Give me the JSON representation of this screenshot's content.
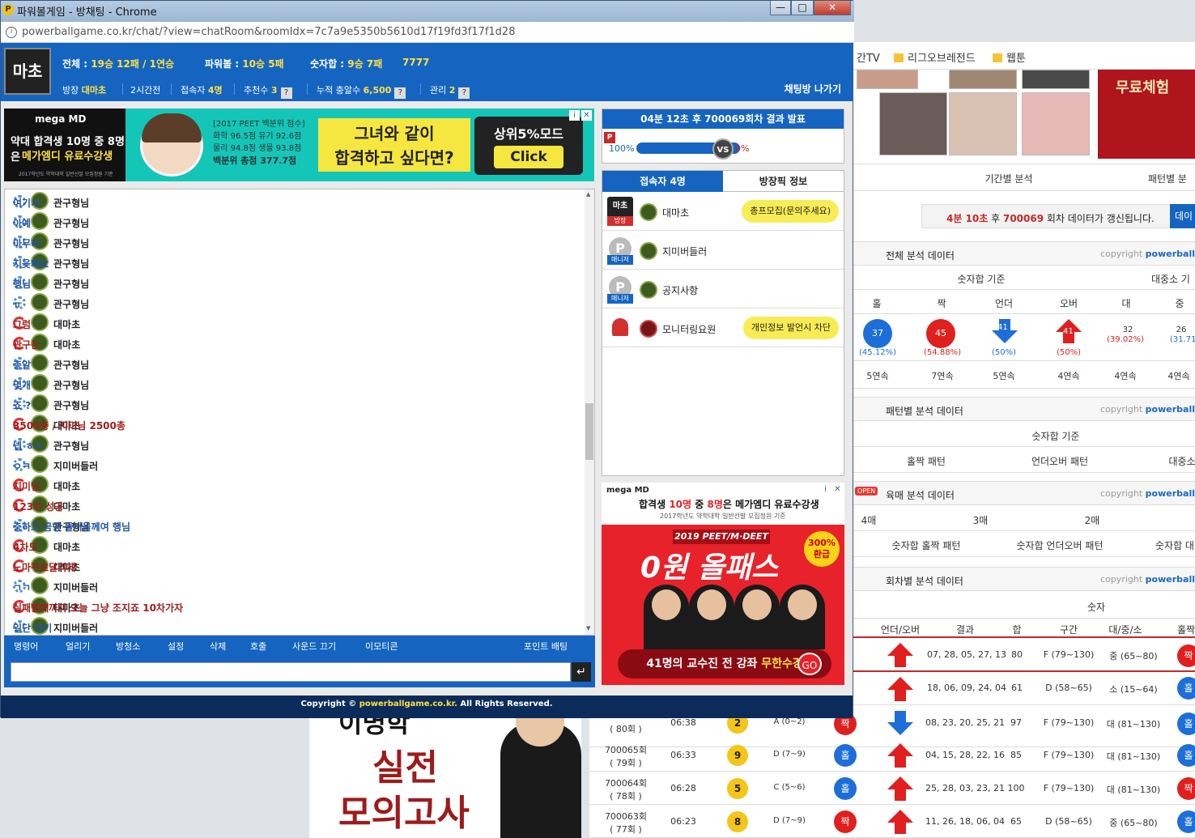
{
  "window": {
    "title": "파워볼게임 - 방채팅 - Chrome",
    "url": "powerballgame.co.kr/chat/?view=chatRoom&roomIdx=7c7a9e5350b5610d17f19fd3f17f1d28",
    "min": "—",
    "max": "□",
    "close": "✕"
  },
  "header": {
    "avatar_text": "마초",
    "total_label": "전체 : ",
    "total_value": "19승 12패 / 1연승",
    "powerball_label": "파워볼 : ",
    "powerball_value": "10승 5패",
    "number_label": "숫자합 : ",
    "number_value": "9승 7패",
    "extra": "7777",
    "host_label": "방장",
    "host_value": "대마초",
    "time": "2시간전",
    "users_label": "접속자",
    "users_value": "4명",
    "recommend_label": "추천수",
    "recommend_value": "3",
    "cumulative_label": "누적 충알수",
    "cumulative_value": "6,500",
    "manage_label": "관리",
    "manage_value": "2",
    "help": "?",
    "exit": "채팅방 나가기"
  },
  "ad_top": {
    "brand": "mega MD",
    "line1": "약대 합격생 10명 중 8명은",
    "line2": "메가엠디 유료수강생",
    "fine": "2017학년도 약학대학 일반선발 모집정원 기준",
    "scores": [
      "[2017 PEET 백분위 점수]",
      "화학 96.5점  유기 92.6점",
      "물리 94.8점  생물 93.8점",
      "백분위 총점 377.7점"
    ],
    "slogan1": "그녀와 같이",
    "slogan2": "합격하고 싶다면?",
    "cta_title": "상위5%모드",
    "cta_button": "Click"
  },
  "messages": [
    {
      "icon": "blue",
      "nick": "관구형님",
      "text": "여기서",
      "color": "bl"
    },
    {
      "icon": "blue",
      "nick": "관구형님",
      "text": "아예",
      "color": "bl"
    },
    {
      "icon": "blue",
      "nick": "관구형님",
      "text": "마무리",
      "color": "bl"
    },
    {
      "icon": "blue",
      "nick": "관구형님",
      "text": "지읒폐요",
      "color": "bl"
    },
    {
      "icon": "blue",
      "nick": "관구형님",
      "text": "행님",
      "color": "bl"
    },
    {
      "icon": "blue",
      "nick": "관구형님",
      "text": "ㅠ",
      "color": "bl"
    },
    {
      "icon": "red",
      "nick": "대마초",
      "text": "그럼",
      "color": "rd"
    },
    {
      "icon": "red",
      "nick": "대마초",
      "text": "관구는",
      "color": "rd"
    },
    {
      "icon": "blue",
      "nick": "관구형님",
      "text": "총알",
      "color": "bl"
    },
    {
      "icon": "blue",
      "nick": "관구형님",
      "text": "몇개",
      "color": "bl"
    },
    {
      "icon": "blue",
      "nick": "관구형님",
      "text": "죠 ?",
      "color": "bl"
    },
    {
      "icon": "red",
      "nick": "대마초",
      "text": "3500총 / 지미님 2500총",
      "color": "rd"
    },
    {
      "icon": "blue",
      "nick": "관구형님",
      "text": "넵 ㅎㅎ",
      "color": "bl"
    },
    {
      "icon": "blue",
      "nick": "지미버들러",
      "text": "ㅇㅋ",
      "color": "bl"
    },
    {
      "icon": "red",
      "nick": "대마초",
      "text": "지미님",
      "color": "rd"
    },
    {
      "icon": "red",
      "nick": "대마초",
      "text": "123차 성공",
      "color": "rd"
    },
    {
      "icon": "blue",
      "nick": "관구형님",
      "text": "충하고 금방 들어올께여 행님",
      "color": "bl"
    },
    {
      "icon": "red",
      "nick": "대마초",
      "text": "4차도",
      "color": "rd"
    },
    {
      "icon": "red",
      "nick": "대마초",
      "text": "노마꾸로달리제",
      "color": "rd"
    },
    {
      "icon": "blue",
      "nick": "지미버들러",
      "text": "ㄱㄱ",
      "color": "bl"
    },
    {
      "icon": "red",
      "nick": "대마초",
      "text": "실패할때까지 오늘 그냥 조지죠 10차가자",
      "color": "rd"
    },
    {
      "icon": "blue",
      "nick": "지미버들러",
      "text": "일단 대기",
      "color": "bl"
    }
  ],
  "toolbar": {
    "items": [
      "명령어",
      "얼리기",
      "방청소",
      "설정",
      "삭제",
      "호출",
      "사운드 끄기",
      "이모티콘"
    ],
    "point_bet": "포인트 배팅",
    "enter": "↵"
  },
  "footer": {
    "prefix": "Copyright ©",
    "domain": "powerballgame.co.kr.",
    "suffix": "All Rights Reserved."
  },
  "result": {
    "header": "04분 12초 후 700069회차 결과 발표",
    "p": "P",
    "left_pct": "100%",
    "right_pct": "0%",
    "vs": "VS"
  },
  "userpanel": {
    "tab_users": "접속자 4명",
    "tab_info": "방장픽 정보",
    "users": [
      {
        "name": "대마초",
        "role": "방장",
        "role_color": "#d32f2f",
        "tag": "총프모집(문의주세요)",
        "avatar": "마초"
      },
      {
        "name": "지미버들러",
        "role": "매니저",
        "role_color": "#1565c0",
        "tag": "",
        "avatar": "P"
      },
      {
        "name": "공지사항",
        "role": "매니저",
        "role_color": "#1565c0",
        "tag": "",
        "avatar": "P"
      },
      {
        "name": "모니터링요원",
        "role": "",
        "role_color": "",
        "tag": "개인정보 발언시 차단",
        "avatar": ""
      }
    ]
  },
  "ad_side": {
    "brand": "mega MD",
    "headline_pre": "합격생 ",
    "headline_b1": "10명",
    "headline_mid": " 중 ",
    "headline_b2": "8명",
    "headline_post": "은 메가엠디 유료수강생",
    "sub": "2017학년도 약학대학 일반선발 모집정원 기준",
    "pill": "2019 PEET/M·DEET",
    "big": "0원 올패스",
    "badge": "300% 환급",
    "bottom_pre": "41명의 교수진 전 강좌 ",
    "bottom_b": "무한수강",
    "go": "GO"
  },
  "bg": {
    "bookmarks": [
      "간TV",
      "리그오브레전드",
      "웹툰"
    ],
    "ad_text": "무료체험",
    "tab1": "기간별 분석",
    "tab2": "패턴별 분",
    "notice_time": "4분 10초",
    "notice_mid": " 후 ",
    "notice_round": "700069",
    "notice_suffix": " 회차 데이터가 갱신됩니다.",
    "notice_btn": "데이",
    "sec1": "전체 분석 데이터",
    "sec2": "패턴별 분석 데이터",
    "sec3": "육매 분석 데이터",
    "sec4": "회차별 분석 데이터",
    "copyright": "copyright",
    "copyright_b": "powerball",
    "sumbase": "숫자합 기준",
    "bigmid": "대중소 기",
    "cols": [
      "홀",
      "짝",
      "언더",
      "오버",
      "대",
      "중"
    ],
    "vals": [
      "37",
      "45",
      "41",
      "41",
      "32",
      "26"
    ],
    "pcts": [
      "(45.12%)",
      "(54.88%)",
      "(50%)",
      "(50%)",
      "(39.02%)",
      "(31.71%"
    ],
    "streaks": [
      "5연속",
      "7연속",
      "5연속",
      "4연속",
      "4연속",
      "4연속"
    ],
    "sumbase2": "숫자합 기준",
    "pat": [
      "홀짝 패턴",
      "언더오버 패턴",
      "대중소"
    ],
    "open": "OPEN",
    "six": [
      "4매",
      "3매",
      "2매"
    ],
    "six2": [
      "숫자합 홀짝 패턴",
      "숫자합 언더오버 패턴",
      "숫자합 대"
    ],
    "num": "숫자",
    "th": [
      "언더/오버",
      "결과",
      "합",
      "구간",
      "대/중/소",
      "홀짝"
    ],
    "rows": [
      {
        "nums": "07, 28, 05, 27, 13",
        "sum": "80",
        "zone": "F (79~130)",
        "size": "중 (65~80)",
        "oe": "짝"
      },
      {
        "nums": "18, 06, 09, 24, 04",
        "sum": "61",
        "zone": "D (58~65)",
        "size": "소 (15~64)",
        "oe": "홀"
      },
      {
        "nums": "08, 23, 20, 25, 21",
        "sum": "97",
        "zone": "F (79~130)",
        "size": "대 (81~130)",
        "oe": "홀"
      }
    ],
    "lower": [
      {
        "round": "( 80회 )",
        "time": "06:38",
        "ball": "2",
        "zone": "A (0~2)",
        "oe": "짝",
        "dir": "down",
        "nums": "08, 23, 20, 25, 21",
        "sum": "97",
        "zone2": "F (79~130)",
        "size": "대 (81~130)",
        "oe2": "홀"
      },
      {
        "round": "700065회",
        "round2": "( 79회 )",
        "time": "06:33",
        "ball": "9",
        "zone": "D (7~9)",
        "oe": "홀",
        "dir": "up",
        "nums": "04, 15, 28, 22, 16",
        "sum": "85",
        "zone2": "F (79~130)",
        "size": "대 (81~130)",
        "oe2": "홀"
      },
      {
        "round": "700064회",
        "round2": "( 78회 )",
        "time": "06:28",
        "ball": "5",
        "zone": "C (5~6)",
        "oe": "홀",
        "dir": "up",
        "nums": "25, 28, 03, 23, 21",
        "sum": "100",
        "zone2": "F (79~130)",
        "size": "대 (81~130)",
        "oe2": "짝"
      },
      {
        "round": "700063회",
        "round2": "( 77회 )",
        "time": "06:23",
        "ball": "8",
        "zone": "D (7~9)",
        "oe": "짝",
        "dir": "up",
        "nums": "11, 26, 18, 06, 04",
        "sum": "65",
        "zone2": "D (58~65)",
        "size": "중 (65~80)",
        "oe2": "홀"
      }
    ],
    "ad2_a": "이명학",
    "ad2_b": "실전",
    "ad2_c": "모의고사"
  },
  "colors": {
    "brand_blue": "#1565c0",
    "accent_yellow": "#ffe044",
    "odd_blue": "#1d6ed8",
    "even_red": "#e01f1f"
  }
}
